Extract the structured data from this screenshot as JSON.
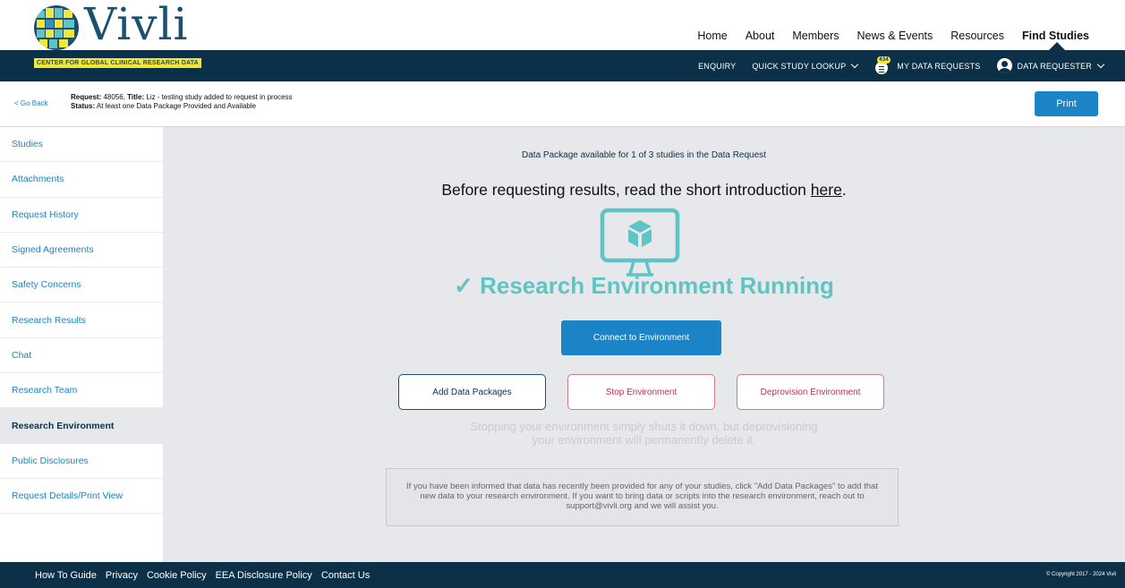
{
  "brand": {
    "logo_text": "Vivli",
    "tagline": "CENTER FOR GLOBAL CLINICAL RESEARCH DATA",
    "colors": {
      "navy": "#0c3048",
      "accent_blue": "#1a84c7",
      "teal": "#5fc4c4",
      "yellow": "#f2e639",
      "danger": "#c0334f"
    }
  },
  "top_nav": {
    "home": "Home",
    "about": "About",
    "members": "Members",
    "news_events": "News & Events",
    "resources": "Resources",
    "find_studies": "Find Studies"
  },
  "dark_nav": {
    "enquiry": "ENQUIRY",
    "quick_lookup": "QUICK STUDY LOOKUP",
    "requests_badge": "434",
    "my_data_requests": "MY DATA REQUESTS",
    "user_role": "DATA REQUESTER"
  },
  "request_bar": {
    "go_back": "< Go Back",
    "request_label": "Request:",
    "request_id": "48056,",
    "title_label": "Title:",
    "title_value": "Liz - testing study added to request in process",
    "status_label": "Status:",
    "status_value": "At least one Data Package Provided and Available",
    "print_label": "Print"
  },
  "sidebar": {
    "items": [
      {
        "label": "Studies"
      },
      {
        "label": "Attachments"
      },
      {
        "label": "Request History"
      },
      {
        "label": "Signed Agreements"
      },
      {
        "label": "Safety Concerns"
      },
      {
        "label": "Research Results"
      },
      {
        "label": "Chat"
      },
      {
        "label": "Research Team"
      },
      {
        "label": "Research Environment"
      },
      {
        "label": "Public Disclosures"
      },
      {
        "label": "Request Details/Print View"
      }
    ],
    "active_index": 8
  },
  "main": {
    "package_status": "Data Package available for 1 of 3 studies in the Data Request",
    "intro_prefix": "Before requesting results, read the short introduction ",
    "intro_link": "here",
    "intro_suffix": ".",
    "running_check": "✓",
    "running_text": "Research Environment Running",
    "connect_label": "Connect to Environment",
    "add_packages_label": "Add Data Packages",
    "stop_label": "Stop Environment",
    "deprovision_label": "Deprovision Environment",
    "explain_line1": "Stopping your environment simply shuts it down, but deprovisioning",
    "explain_line2": "your environment will permanently delete it.",
    "info_text": "If you have been informed that data has recently been provided for any of your studies, click \"Add Data Packages\" to add that new data to your research environment. If you want to bring data or scripts into the research environment, reach out to support@vivli.org and we will assist you."
  },
  "footer": {
    "links": [
      "How To Guide",
      "Privacy",
      "Cookie Policy",
      "EEA Disclosure Policy",
      "Contact Us"
    ],
    "copyright": "© Copyright 2017 - 2024 Vivli"
  }
}
